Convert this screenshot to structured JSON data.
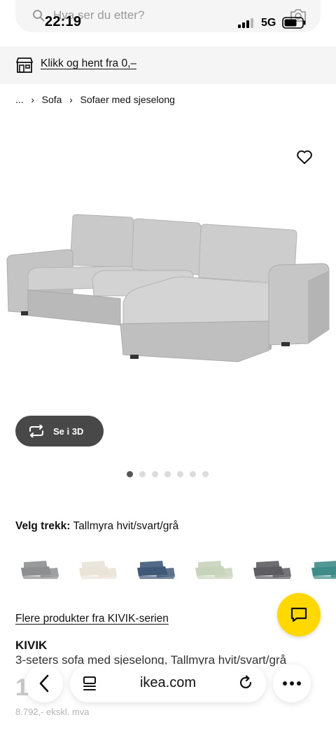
{
  "status_bar": {
    "time": "22:19",
    "network": "5G"
  },
  "search": {
    "placeholder": "Hva ser du etter?"
  },
  "banner": {
    "link_text": "Klikk og hent fra 0,–"
  },
  "breadcrumb": {
    "items": [
      "...",
      "Sofa",
      "Sofaer med sjeselong"
    ]
  },
  "gallery": {
    "view_3d_label": "Se i 3D",
    "dot_count": 7,
    "active_dot": 0
  },
  "fabric": {
    "label": "Velg trekk:",
    "value": "Tallmyra hvit/svart/grå"
  },
  "swatch_colors": [
    "#8e8f90",
    "#e9e3d8",
    "#3f5a78",
    "#c8d3bb",
    "#5d5d62",
    "#3e8c87"
  ],
  "series_link": "Flere produkter fra KIVIK-serien",
  "product": {
    "name": "KIVIK",
    "description": "3-seters sofa med sjeselong, Tallmyra hvit/svart/grå",
    "price_partial": "1",
    "price_excl": "8.792,- ekskl. mva"
  },
  "browser": {
    "url": "ikea.com"
  },
  "colors": {
    "chat_button": "#ffd800",
    "view3d_button": "#484848"
  }
}
